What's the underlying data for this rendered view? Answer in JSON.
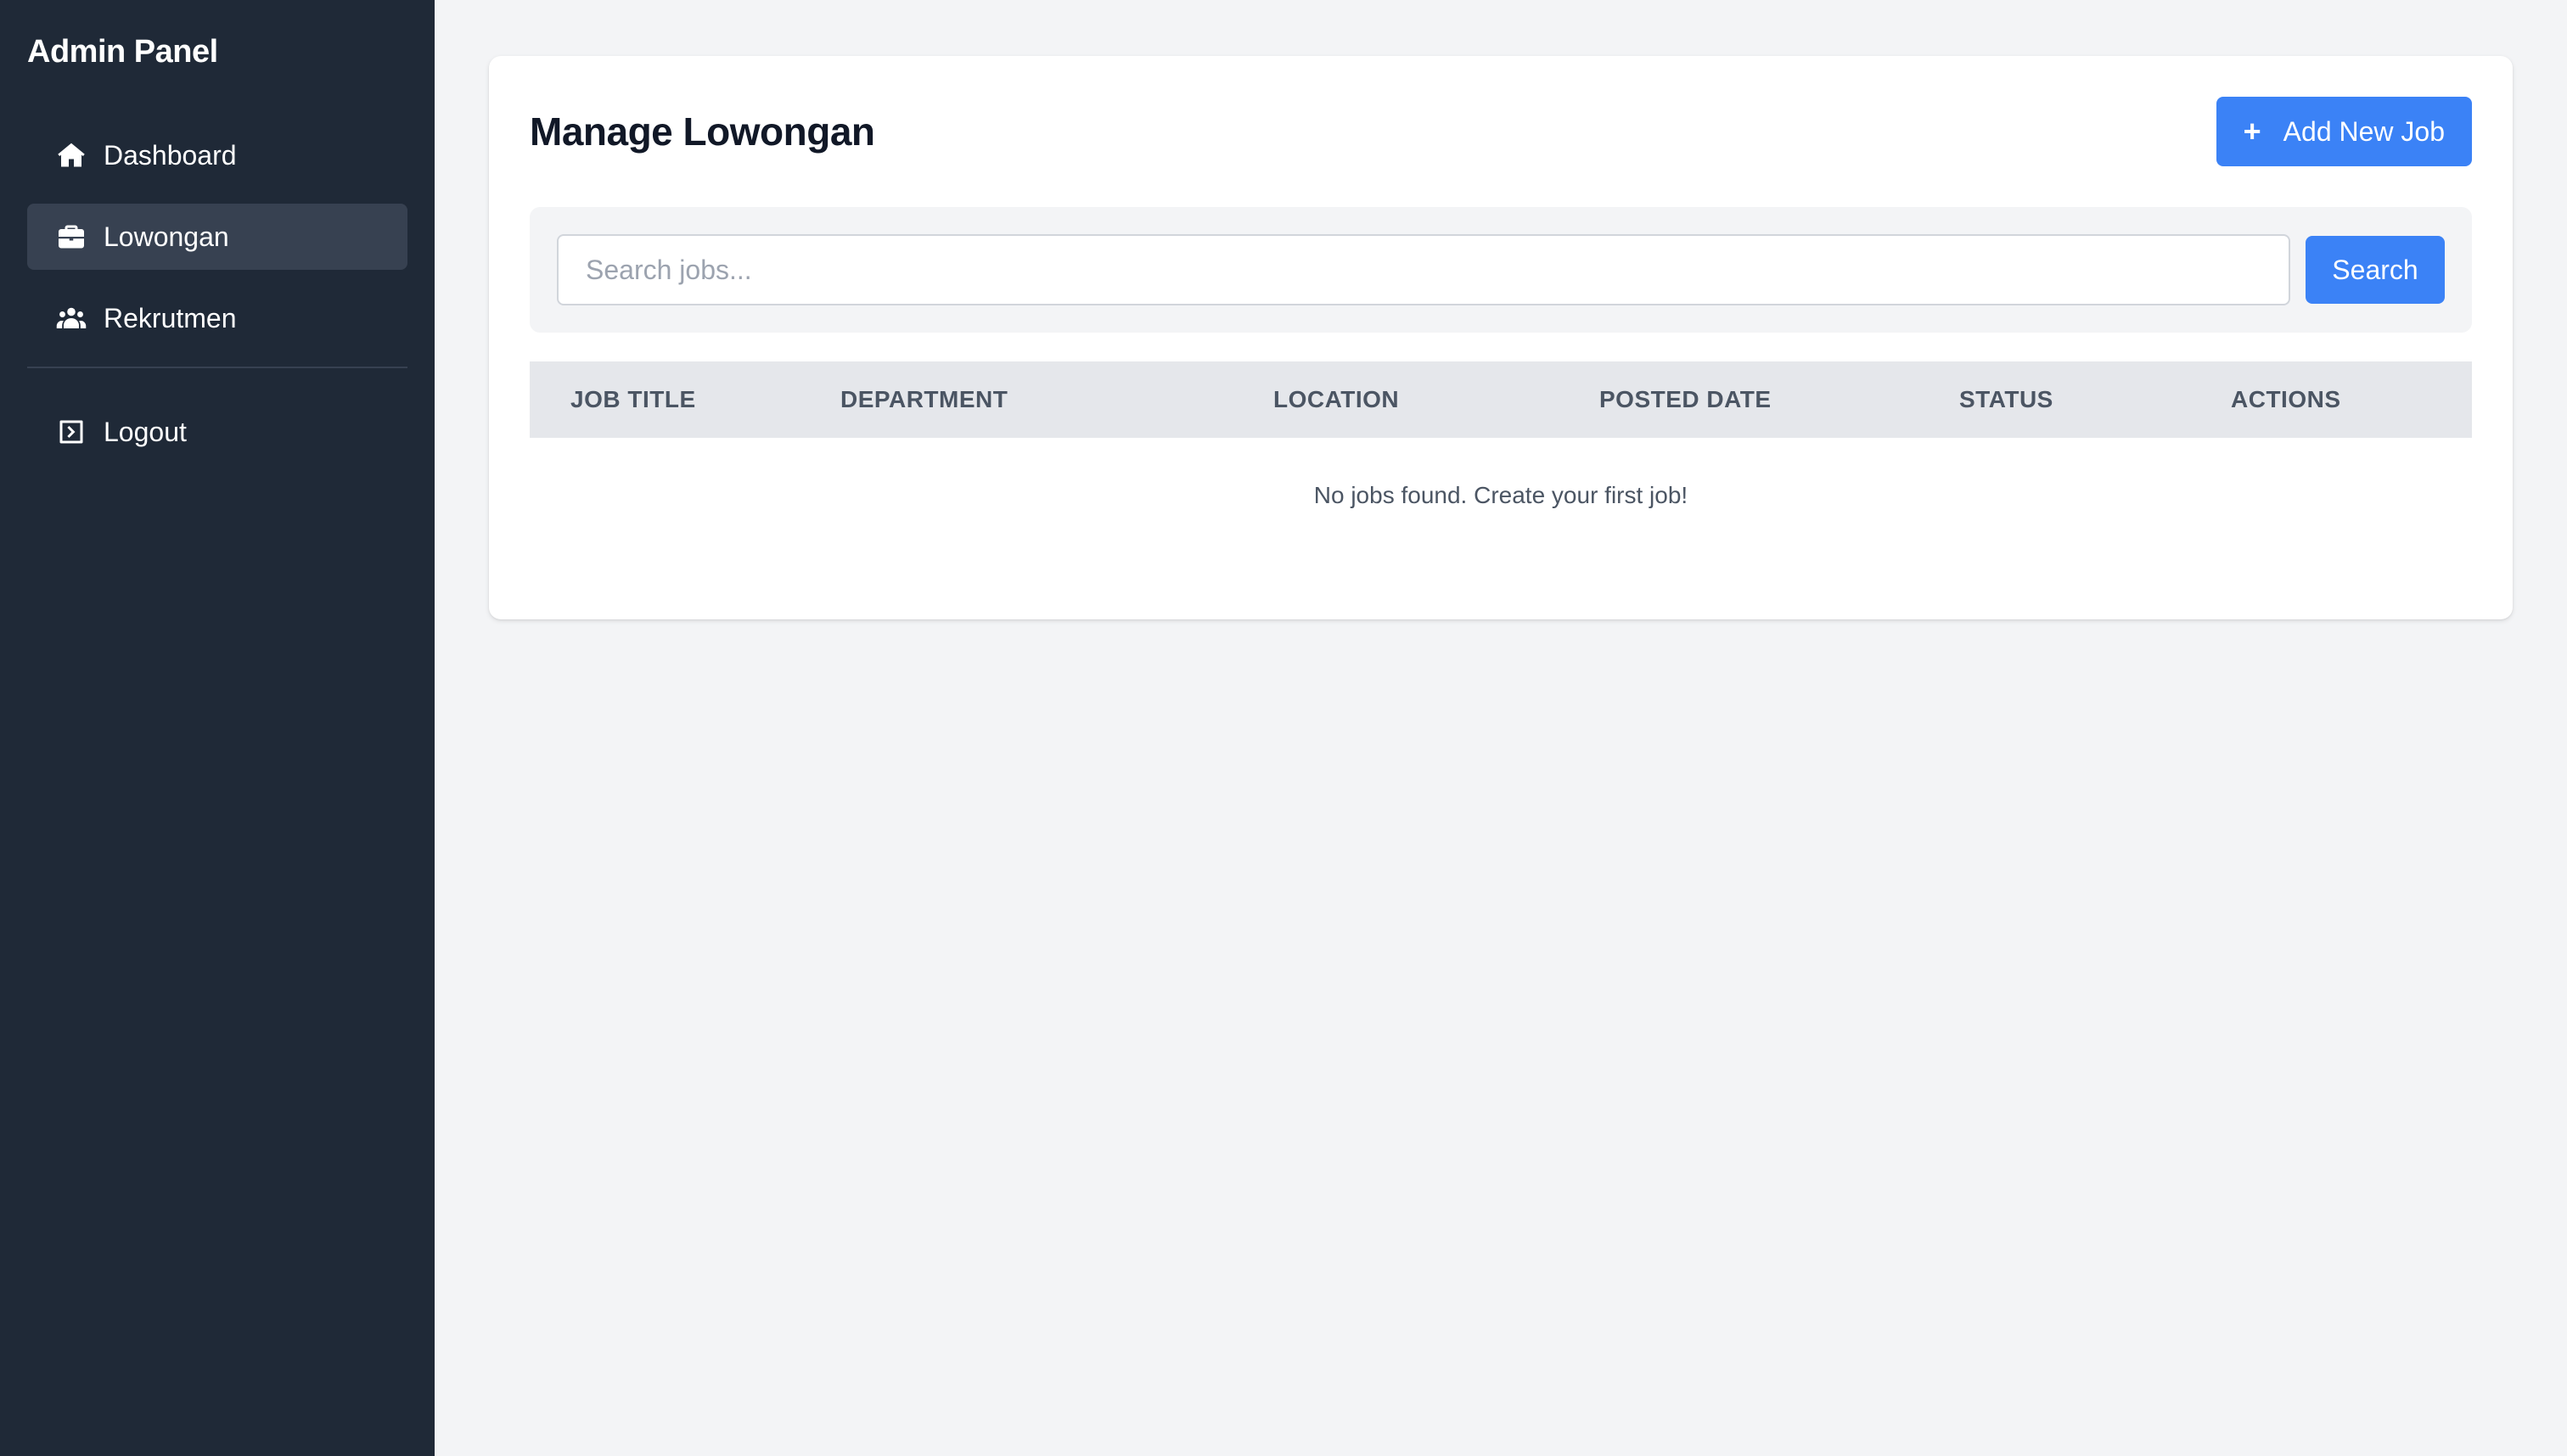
{
  "sidebar": {
    "title": "Admin Panel",
    "items": [
      {
        "label": "Dashboard",
        "icon": "home-icon",
        "active": false
      },
      {
        "label": "Lowongan",
        "icon": "briefcase-icon",
        "active": true
      },
      {
        "label": "Rekrutmen",
        "icon": "users-icon",
        "active": false
      }
    ],
    "logout_label": "Logout"
  },
  "main": {
    "page_title": "Manage Lowongan",
    "add_button_label": "Add New Job",
    "search": {
      "placeholder": "Search jobs...",
      "value": "",
      "button_label": "Search"
    },
    "table": {
      "columns": [
        "JOB TITLE",
        "DEPARTMENT",
        "LOCATION",
        "POSTED DATE",
        "STATUS",
        "ACTIONS"
      ],
      "rows": [],
      "empty_message": "No jobs found. Create your first job!"
    }
  },
  "colors": {
    "sidebar_bg": "#1f2937",
    "active_item_bg": "#374151",
    "accent": "#3b82f6",
    "page_bg": "#f3f4f6"
  }
}
